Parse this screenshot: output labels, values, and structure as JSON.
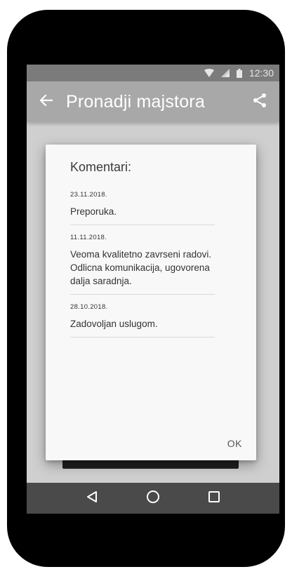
{
  "status_bar": {
    "time": "12:30",
    "icons": [
      "wifi-icon",
      "signal-icon",
      "battery-icon"
    ]
  },
  "app_bar": {
    "title": "Pronadji majstora",
    "back_icon": "arrow-back-icon",
    "share_icon": "share-icon"
  },
  "dialog": {
    "title": "Komentari:",
    "comments": [
      {
        "date": "23.11.2018.",
        "text": "Preporuka."
      },
      {
        "date": "11.11.2018.",
        "text": "Veoma kvalitetno zavrseni radovi. Odlicna komunikacija, ugovorena dalja saradnja."
      },
      {
        "date": "28.10.2018.",
        "text": "Zadovoljan uslugom."
      }
    ],
    "ok_label": "OK"
  },
  "nav_bar": {
    "buttons": [
      "back-triangle-icon",
      "home-circle-icon",
      "recents-square-icon"
    ]
  },
  "colors": {
    "status_bar": "#7b7b7b",
    "app_bar": "#a8a8a8",
    "screen_background": "#cfcfcf",
    "dialog_background": "#f8f8f8",
    "nav_bar": "#4a4a4a"
  }
}
